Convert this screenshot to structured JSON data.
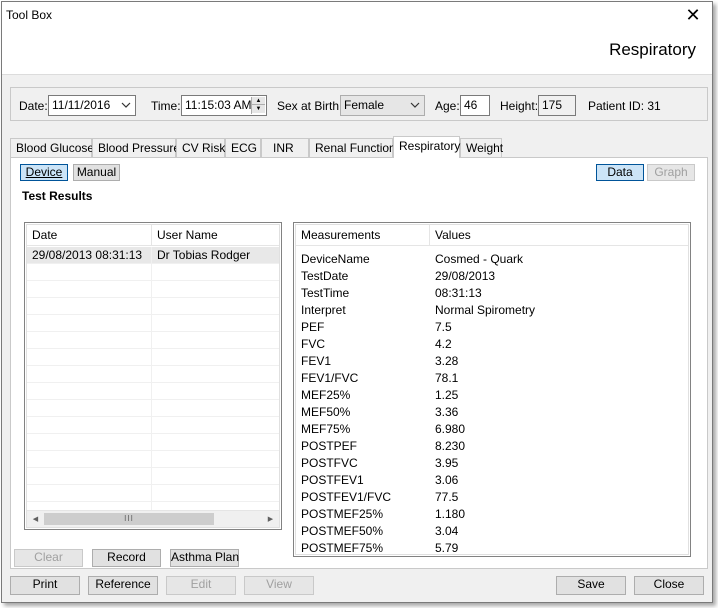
{
  "window": {
    "title": "Tool Box",
    "header_title": "Respiratory",
    "close_glyph": "✕"
  },
  "info": {
    "date_label": "Date:",
    "date_value": "11/11/2016",
    "time_label": "Time:",
    "time_value": "11:15:03 AM",
    "sex_label": "Sex at Birth:",
    "sex_value": "Female",
    "age_label": "Age:",
    "age_value": "46",
    "height_label": "Height:",
    "height_value": "175",
    "patient_id_label": "Patient ID: 31"
  },
  "tabs": [
    "Blood Glucose",
    "Blood Pressure",
    "CV Risk",
    "ECG",
    "INR",
    "Renal Function",
    "Respiratory",
    "Weight"
  ],
  "active_tab": "Respiratory",
  "mode_buttons": {
    "device": "Device",
    "manual": "Manual",
    "data": "Data",
    "graph": "Graph"
  },
  "section_title": "Test Results",
  "results_table": {
    "headers": [
      "Date",
      "User Name"
    ],
    "rows": [
      {
        "date": "29/08/2013 08:31:13",
        "user": "Dr Tobias Rodger"
      }
    ],
    "scroll_thumb": "III"
  },
  "measurements_table": {
    "headers": [
      "Measurements",
      "Values"
    ],
    "rows": [
      {
        "name": "DeviceName",
        "value": "Cosmed - Quark"
      },
      {
        "name": "TestDate",
        "value": "29/08/2013"
      },
      {
        "name": "TestTime",
        "value": "08:31:13"
      },
      {
        "name": "Interpret",
        "value": "Normal Spirometry"
      },
      {
        "name": "PEF",
        "value": "7.5"
      },
      {
        "name": "FVC",
        "value": "4.2"
      },
      {
        "name": "FEV1",
        "value": "3.28"
      },
      {
        "name": "FEV1/FVC",
        "value": "78.1"
      },
      {
        "name": "MEF25%",
        "value": "1.25"
      },
      {
        "name": "MEF50%",
        "value": "3.36"
      },
      {
        "name": "MEF75%",
        "value": "6.980"
      },
      {
        "name": "POSTPEF",
        "value": "8.230"
      },
      {
        "name": "POSTFVC",
        "value": "3.95"
      },
      {
        "name": "POSTFEV1",
        "value": "3.06"
      },
      {
        "name": "POSTFEV1/FVC",
        "value": "77.5"
      },
      {
        "name": "POSTMEF25%",
        "value": "1.180"
      },
      {
        "name": "POSTMEF50%",
        "value": "3.04"
      },
      {
        "name": "POSTMEF75%",
        "value": "5.79"
      }
    ]
  },
  "panel_buttons": {
    "clear": "Clear",
    "record": "Record",
    "asthma_plan": "Asthma Plan"
  },
  "footer_buttons": {
    "print": "Print",
    "reference": "Reference",
    "edit": "Edit",
    "view": "View",
    "save": "Save",
    "close": "Close"
  }
}
